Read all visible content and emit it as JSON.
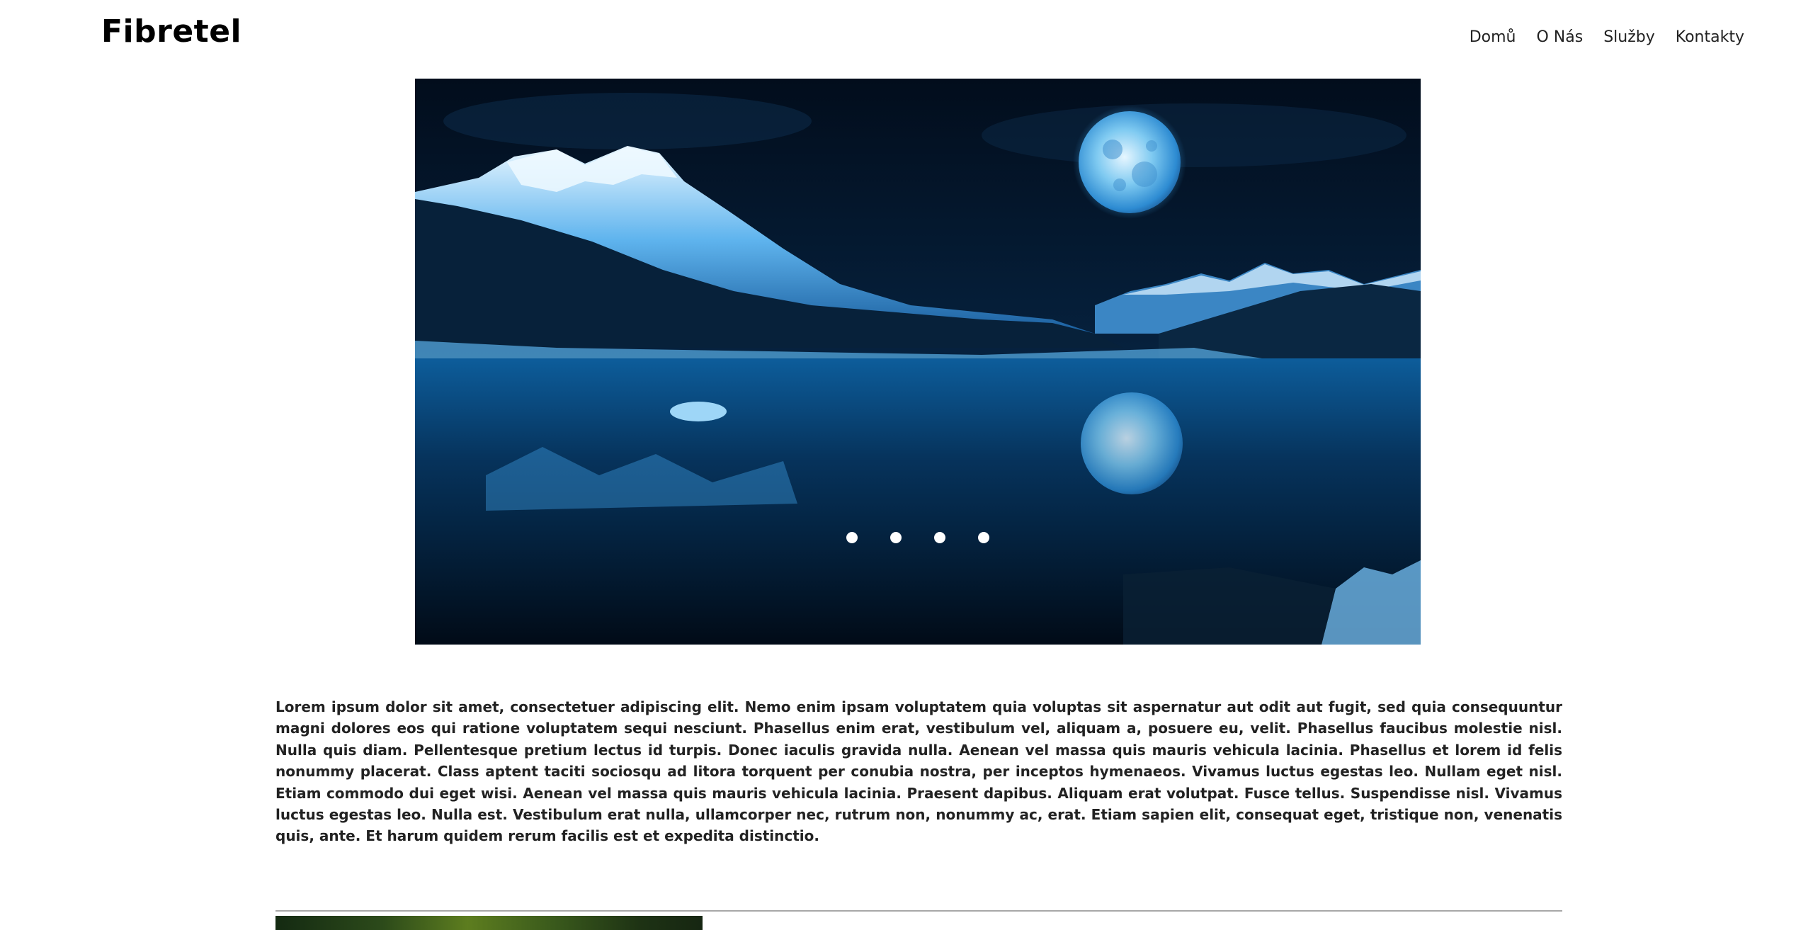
{
  "header": {
    "logo": "Fibretel",
    "nav": [
      {
        "label": "Domů"
      },
      {
        "label": "O Nás"
      },
      {
        "label": "Služby"
      },
      {
        "label": "Kontakty"
      }
    ]
  },
  "slider": {
    "image": "night-lake-moon-mountains",
    "dot_count": 4,
    "dot_color": "#ffffff"
  },
  "main": {
    "paragraph": "Lorem ipsum dolor sit amet, consectetuer adipiscing elit. Nemo enim ipsam voluptatem quia voluptas sit aspernatur aut odit aut fugit, sed quia consequuntur magni dolores eos qui ratione voluptatem sequi nesciunt. Phasellus enim erat, vestibulum vel, aliquam a, posuere eu, velit. Phasellus faucibus molestie nisl. Nulla quis diam. Pellentesque pretium lectus id turpis. Donec iaculis gravida nulla. Aenean vel massa quis mauris vehicula lacinia. Phasellus et lorem id felis nonummy placerat. Class aptent taciti sociosqu ad litora torquent per conubia nostra, per inceptos hymenaeos. Vivamus luctus egestas leo. Nullam eget nisl. Etiam commodo dui eget wisi. Aenean vel massa quis mauris vehicula lacinia. Praesent dapibus. Aliquam erat volutpat. Fusce tellus. Suspendisse nisl. Vivamus luctus egestas leo. Nulla est. Vestibulum erat nulla, ullamcorper nec, rutrum non, nonummy ac, erat. Etiam sapien elit, consequat eget, tristique non, venenatis quis, ante. Et harum quidem rerum facilis est et expedita distinctio."
  },
  "colors": {
    "background": "#ffffff",
    "text": "#222222",
    "slider_dark": "#031c33"
  }
}
